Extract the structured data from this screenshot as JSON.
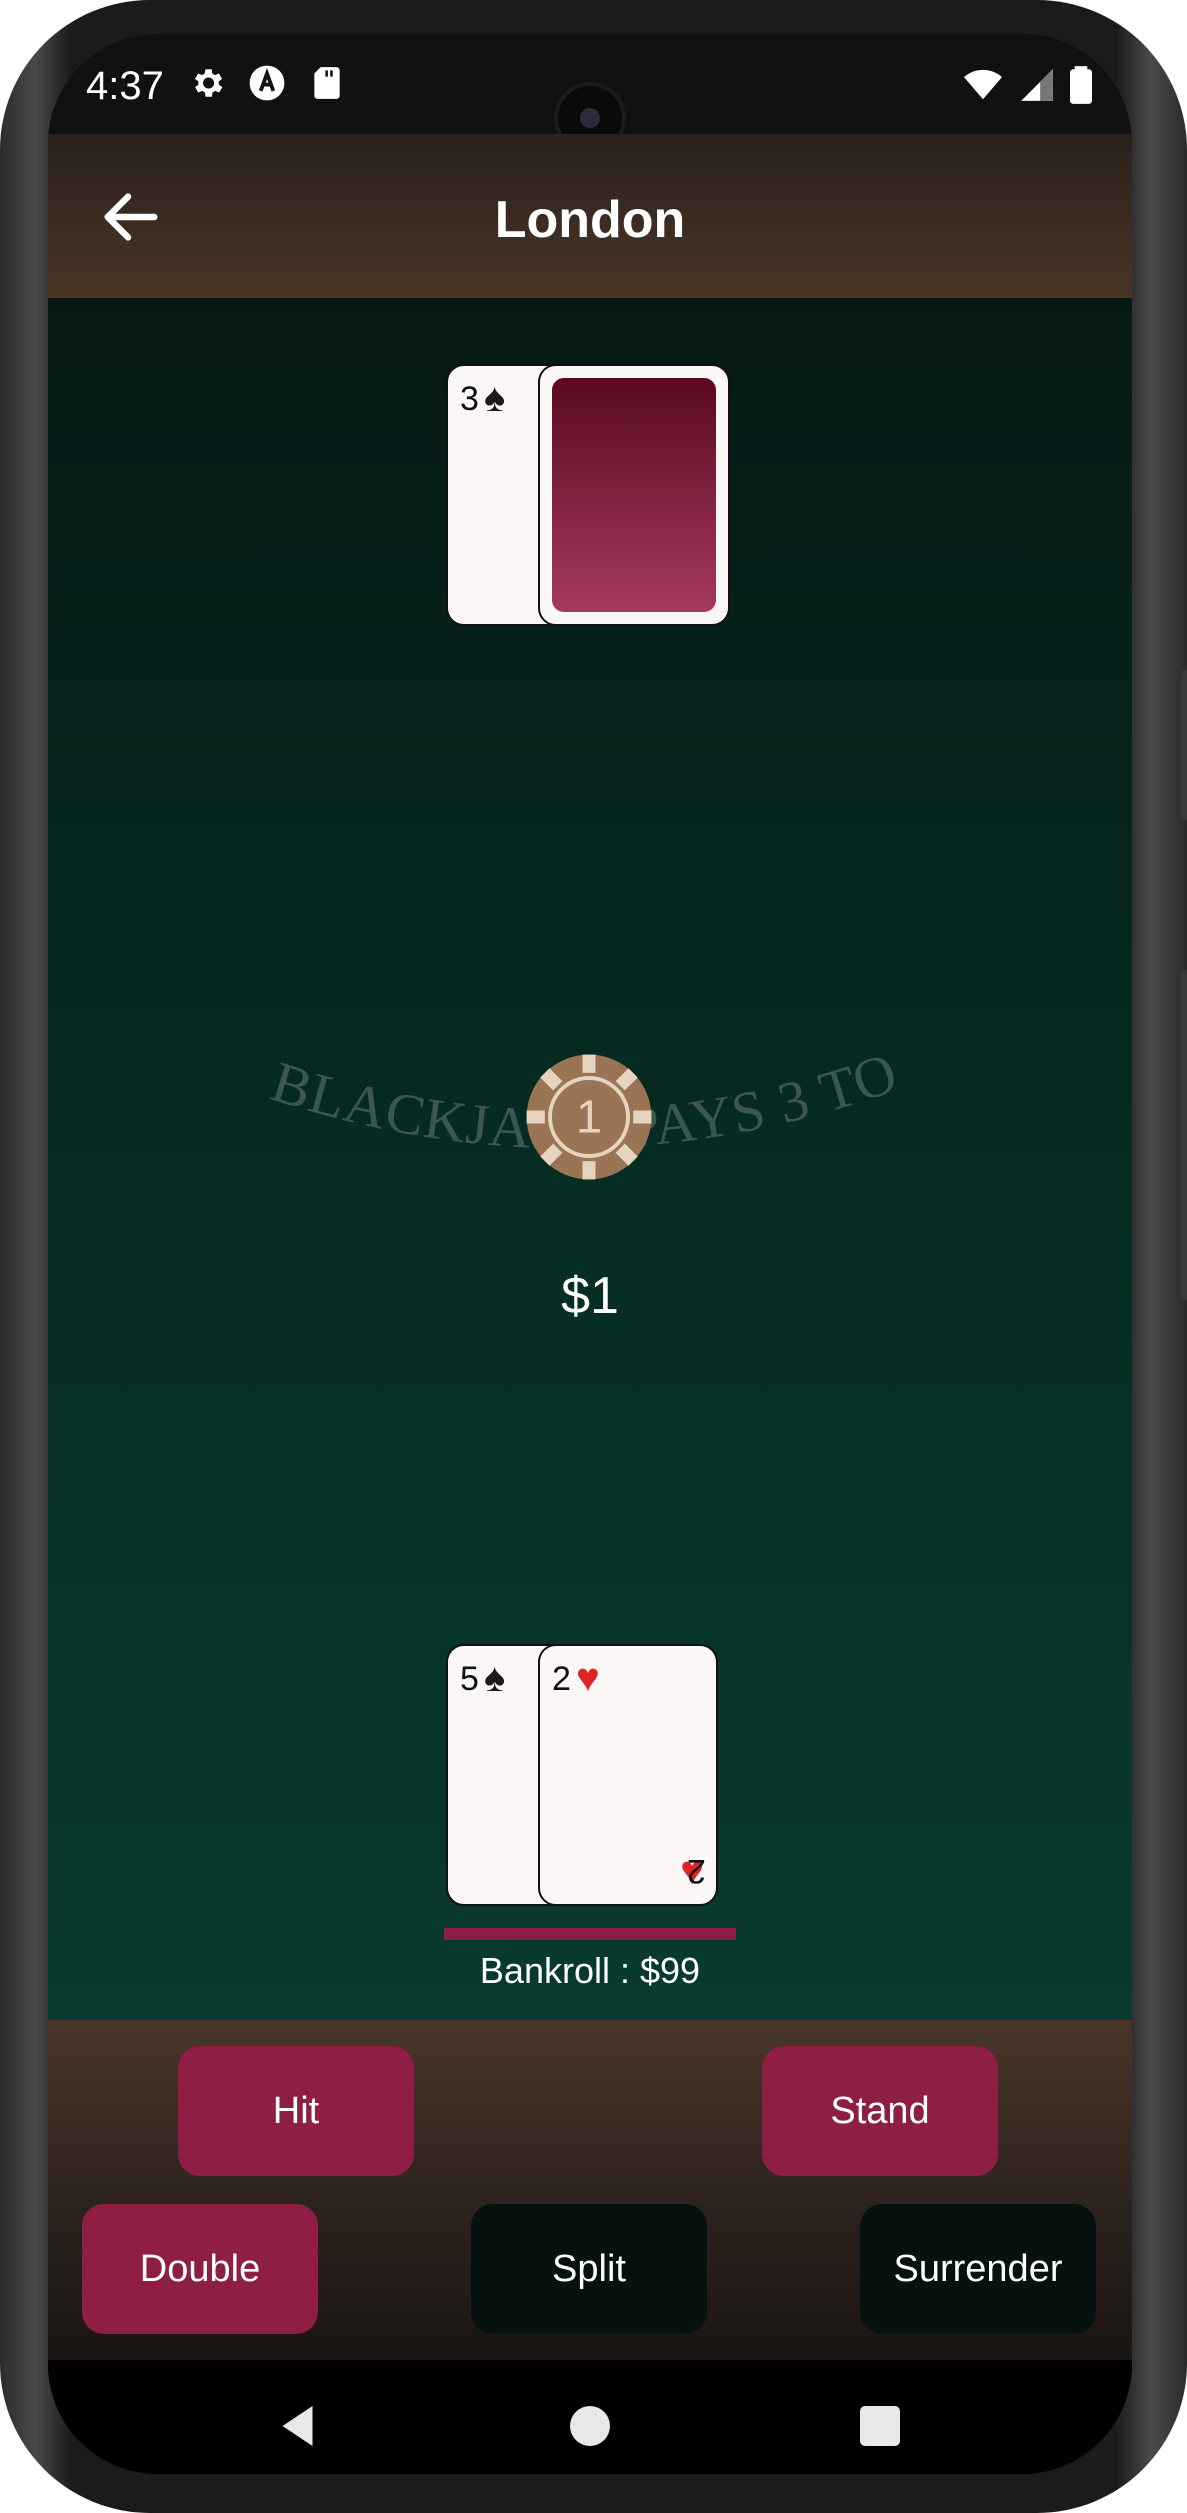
{
  "status_bar": {
    "time": "4:37",
    "icons": [
      "gear-icon",
      "a-icon",
      "sd-card-icon"
    ],
    "right_icons": [
      "wifi-icon",
      "signal-icon",
      "battery-icon"
    ]
  },
  "app_bar": {
    "title": "London",
    "back_icon": "arrow-left-icon"
  },
  "table": {
    "felt_text": "BLACKJACK PAYS 3 TO 2",
    "chip_value": "1",
    "bet_amount": "$1",
    "dealer_hand": [
      {
        "rank": "3",
        "suit": "♠",
        "suit_name": "spades",
        "face_up": true
      },
      {
        "face_up": false
      }
    ],
    "player_hand": [
      {
        "rank": "5",
        "suit": "♠",
        "suit_name": "spades",
        "face_up": true
      },
      {
        "rank": "2",
        "suit": "♥",
        "suit_name": "hearts",
        "face_up": true
      }
    ],
    "bankroll": "Bankroll : $99"
  },
  "actions": {
    "hit": "Hit",
    "stand": "Stand",
    "double": "Double",
    "split": "Split",
    "surrender": "Surrender"
  },
  "colors": {
    "accent": "#8e1e43",
    "felt": "#062a22",
    "wood": "#4a3527",
    "disabled_button": "#061210"
  },
  "nav_bar": {
    "items": [
      "back-triangle-icon",
      "home-circle-icon",
      "recents-square-icon"
    ]
  }
}
